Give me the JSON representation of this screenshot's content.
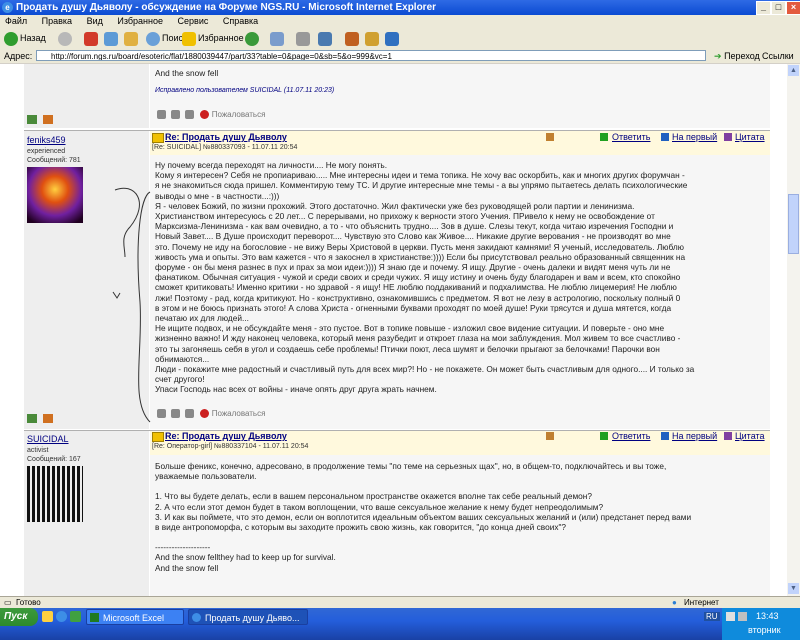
{
  "window": {
    "title": "Продать душу Дьяволу - обсуждение на Форуме NGS.RU - Microsoft Internet Explorer"
  },
  "menu": [
    "Файл",
    "Правка",
    "Вид",
    "Избранное",
    "Сервис",
    "Справка"
  ],
  "toolbar": {
    "back": "Назад",
    "search": "Поиск",
    "favorites": "Избранное"
  },
  "address": {
    "label": "Адрес:",
    "url": "http://forum.ngs.ru/board/esoteric/flat/1880039447/part/33?table=0&page=0&sb=5&o=999&vc=1",
    "go": "Переход",
    "links": "Ссылки"
  },
  "prev_post": {
    "tail": "And the snow fell",
    "edited": "Исправлено пользователем SUICIDAL (11.07.11 20:23)",
    "report": "Пожаловаться"
  },
  "posts": [
    {
      "user": "feniks459",
      "rank": "experienced",
      "messages": "Сообщений: 781",
      "title": "Re: Продать душу Дьяволу",
      "meta": "[Re: SUICIDAL] №880337093 - 11.07.11 20:54",
      "actions": [
        "Ответить",
        "На первый",
        "Цитата"
      ],
      "report": "Пожаловаться",
      "lines": [
        "Ну почему всегда переходят на личности.... Не могу понять.",
        "Кому я интересен? Себя не пропиариваю..... Мне интересны идеи и тема топика. Не хочу вас оскорбить, как и многих других форумчан -",
        "я не знакомиться сюда пришел. Комментирую тему ТС. И другие интересные мне темы - а вы упрямо пытаетесь делать психологические",
        "выводы о мне - в частности...:)))",
        "Я - человек Божий, по жизни прохожий. Этого достаточно. Жил фактически уже без руководящей роли партии и ленинизма.",
        "Христианством интересуюсь с 20 лет... С перерывами, но прихожу к верности этого Учения. ПРивело к нему не освобождение от",
        "Марксизма-Ленинизма - как вам очевидно, а то - что объяснить трудно.... Зов в душе. Слезы текут, когда читаю изречения Господни и",
        "Новый Завет.... В Душе происходит переворот.... Чувствую это Слово как Живое.... Никакие другие верования - не производят во мне",
        "это. Почему не иду на богословие - не вижу Веры Христовой в церкви. Пусть меня закидают камнями! Я ученый, исследователь. Люблю",
        "живость ума и опыты. Это вам кажется - что я закоснел в христианстве:)))) Если бы присутствовал реально образованный священник на",
        "форуме - он бы меня разнес в пух и прах за мои идеи:)))) Я знаю где и почему. Я ищу. Другие - очень далеки и видят меня чуть ли не",
        "фанатиком. Обычная ситуация - чужой и среди своих и среди чужих. Я ищу истину и очень буду благодарен и вам и всем, кто спокойно",
        "сможет критиковать! Именно критики - но здравой - я ищу! НЕ люблю поддакиваний и подхалимства. Не люблю лицемерия! Не люблю",
        "лжи! Поэтому - рад, когда критикуют. Но - конструктивно, ознакомившись с предметом. Я вот не лезу в астрологию, поскольку полный 0",
        "в этом и не боюсь признать этого! А слова Христа - огненными буквами проходят по моей душе! Руки трясутся и душа мятется, когда",
        "печатаю их для людей...",
        "Не ищите подвох, и не обсуждайте меня - это пустое. Вот в топике повыше - изложил свое видение ситуации. И поверьте - оно мне",
        "жизненно важно! И жду наконец человека, который меня разубедит и откроет глаза на мои заблуждения. Мол живем то все счастливо -",
        "это ты загоняешь себя в угол и создаешь себе проблемы! Птички поют, леса шумят и белочки прыгают за белочками! Парочки вон",
        "обнимаются...",
        "Люди - покажите мне радостный и счастливый путь для всех мир?! Но - не покажете. Он может быть счастливым для одного.... И только за",
        "счет другого!",
        "Упаси Господь нас всех от войны - иначе опять друг друга жрать начнем."
      ]
    },
    {
      "user": "SUICIDAL",
      "rank": "activist",
      "messages": "Сообщений: 167",
      "title": "Re: Продать душу Дьяволу",
      "meta": "[Re: Оператор-girl] №880337104 - 11.07.11 20:54",
      "actions": [
        "Ответить",
        "На первый",
        "Цитата"
      ],
      "lines": [
        "Больше феникс, конечно, адресовано, в продолжение темы \"по теме на серьезных щах\", но, в общем-то, подключайтесь и вы тоже,",
        "уважаемые пользователи.",
        "",
        "1. Что вы будете делать, если в вашем персональном пространстве окажется вполне так себе реальный демон?",
        "2. А что если этот демон будет в таком воплощении, что ваше сексуальное желание к нему будет непреодолимым?",
        "3. И как вы поймете, что это демон, если он воплотится идеальным объектом ваших сексуальных желаний и (или) предстанет перед вами",
        "в виде антропоморфа, с которым вы заходите прожить свою жизнь, как говорится, \"до конца дней своих\"?",
        "",
        "--------------------",
        "And the snow fellthey had to keep up for survival.",
        "And the snow fell"
      ]
    }
  ],
  "status": {
    "left": "Готово",
    "zone": "Интернет"
  },
  "taskbar": {
    "start": "Пуск",
    "tasks": [
      "Microsoft Excel",
      "Продать душу Дьяво..."
    ],
    "lang": "RU",
    "time": "13:43",
    "day": "вторник"
  }
}
